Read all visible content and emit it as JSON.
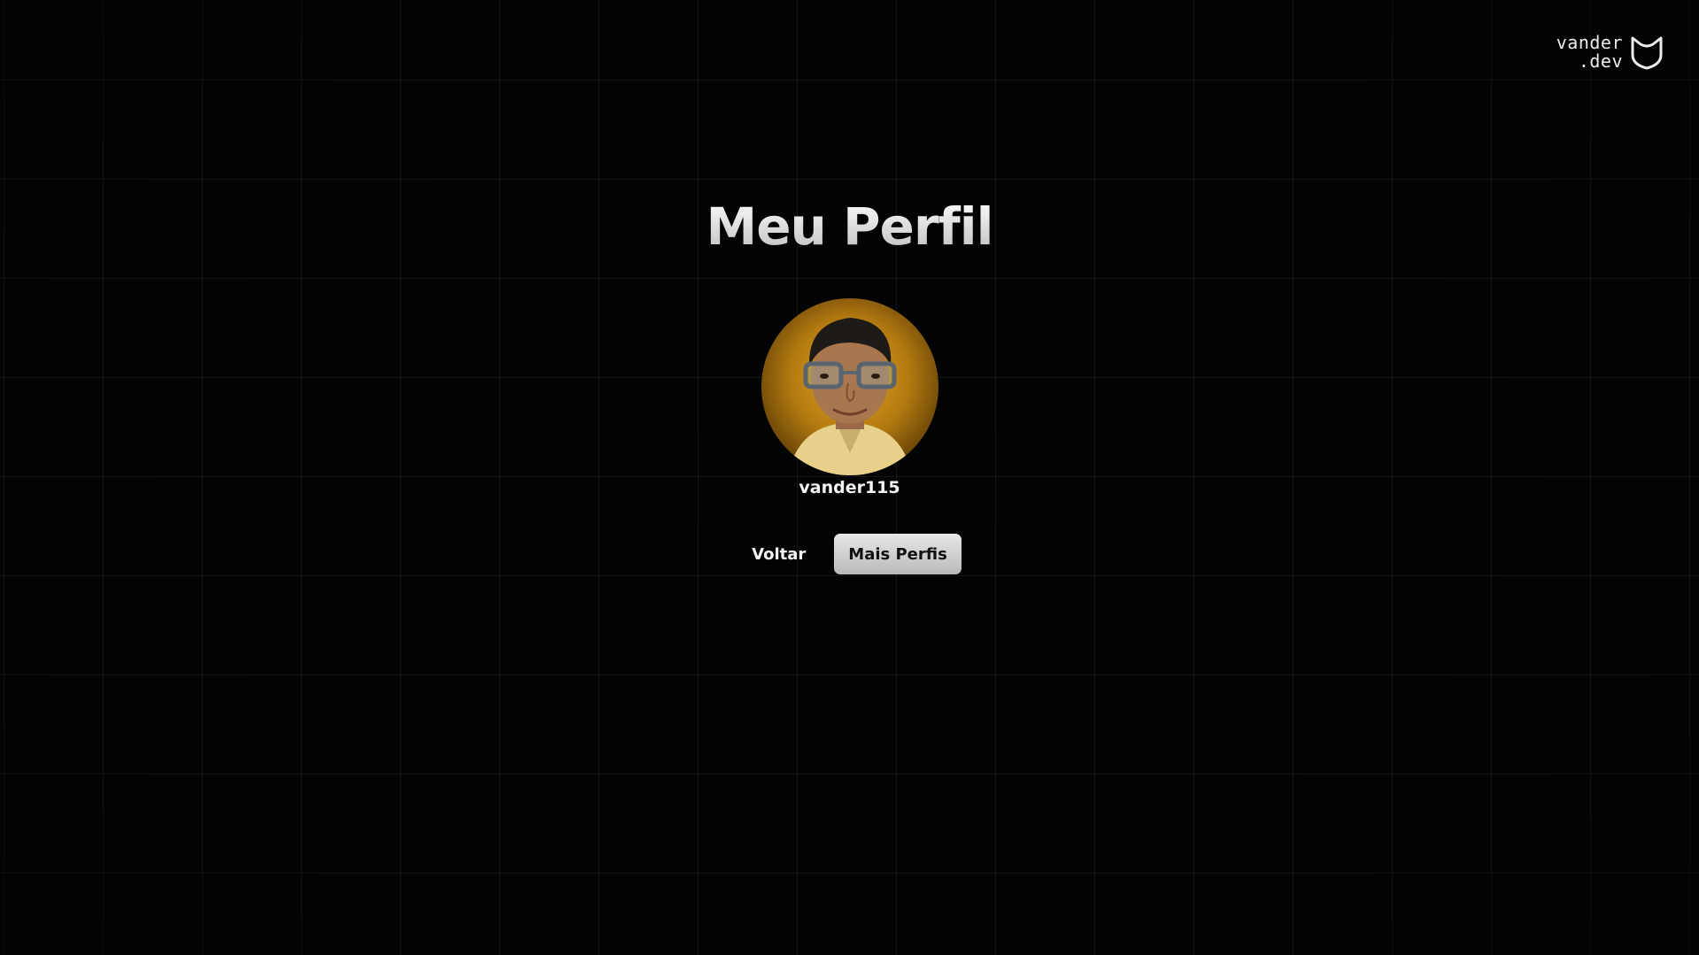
{
  "logo": {
    "line1": "vander",
    "line2": ".dev",
    "icon": "shield-icon"
  },
  "page": {
    "title": "Meu Perfil"
  },
  "profile": {
    "avatar_alt": "profile-photo",
    "username": "vander115"
  },
  "actions": {
    "back_label": "Voltar",
    "more_profiles_label": "Mais Perfis"
  },
  "colors": {
    "background": "#030303",
    "grid_line": "#1a1a1a",
    "avatar_glow": "#e0a420",
    "primary_button": "#d4d4d4"
  }
}
